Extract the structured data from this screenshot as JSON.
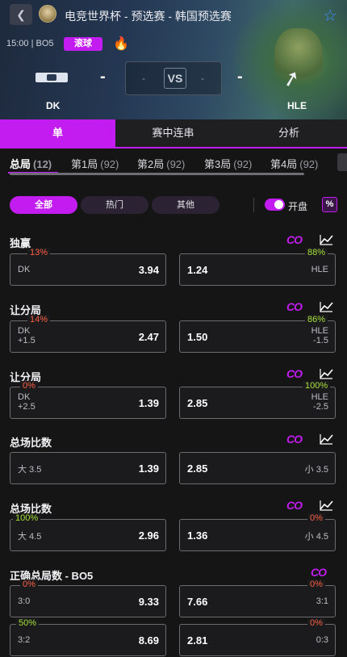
{
  "header": {
    "back_icon": "chevron-left-icon",
    "title": "电竞世界杯 - 预选赛 - 韩国预选赛",
    "time_format": "15:00 | BO5",
    "live_badge": "滚球",
    "fire_icon": "🔥",
    "star_icon": "☆",
    "team_left": "DK",
    "team_right": "HLE",
    "score_left": "-",
    "score_right": "-",
    "vs_label": "VS",
    "vs_left_sub": "-",
    "vs_right_sub": "-"
  },
  "main_tabs": [
    {
      "label": "单",
      "active": true
    },
    {
      "label": "赛中连串",
      "active": false
    },
    {
      "label": "分析",
      "active": false
    }
  ],
  "game_tabs": [
    {
      "label": "总局",
      "count": "(12)",
      "active": true
    },
    {
      "label": "第1局",
      "count": "(92)",
      "active": false
    },
    {
      "label": "第2局",
      "count": "(92)",
      "active": false
    },
    {
      "label": "第3局",
      "count": "(92)",
      "active": false
    },
    {
      "label": "第4局",
      "count": "(92)",
      "active": false
    }
  ],
  "filters": {
    "all": "全部",
    "hot": "热门",
    "other": "其他",
    "toggle_label": "开盘",
    "percent_icon": "%"
  },
  "markets": [
    {
      "title": "独赢",
      "co": "CO",
      "left": {
        "pct": "13%",
        "pct_color": "red",
        "line1": "DK",
        "line2": "",
        "odd": "3.94"
      },
      "right": {
        "pct": "88%",
        "pct_color": "green",
        "line1": "HLE",
        "line2": "",
        "odd": "1.24"
      }
    },
    {
      "title": "让分局",
      "co": "CO",
      "left": {
        "pct": "14%",
        "pct_color": "red",
        "line1": "DK",
        "line2": "+1.5",
        "odd": "2.47"
      },
      "right": {
        "pct": "86%",
        "pct_color": "green",
        "line1": "HLE",
        "line2": "-1.5",
        "odd": "1.50"
      }
    },
    {
      "title": "让分局",
      "co": "CO",
      "left": {
        "pct": "0%",
        "pct_color": "red",
        "line1": "DK",
        "line2": "+2.5",
        "odd": "1.39"
      },
      "right": {
        "pct": "100%",
        "pct_color": "green",
        "line1": "HLE",
        "line2": "-2.5",
        "odd": "2.85"
      }
    },
    {
      "title": "总场比数",
      "co": "CO",
      "left": {
        "pct": "",
        "pct_color": "red",
        "line1": "大 3.5",
        "line2": "",
        "odd": "1.39"
      },
      "right": {
        "pct": "",
        "pct_color": "green",
        "line1": "小 3.5",
        "line2": "",
        "odd": "2.85"
      }
    },
    {
      "title": "总场比数",
      "co": "CO",
      "left": {
        "pct": "100%",
        "pct_color": "green",
        "line1": "大 4.5",
        "line2": "",
        "odd": "2.96"
      },
      "right": {
        "pct": "0%",
        "pct_color": "red",
        "line1": "小 4.5",
        "line2": "",
        "odd": "1.36"
      }
    },
    {
      "title": "正确总局数 - BO5",
      "co": "CO",
      "rows": [
        {
          "left": {
            "pct": "0%",
            "pct_color": "red",
            "line1": "3:0",
            "odd": "9.33"
          },
          "right": {
            "pct": "0%",
            "pct_color": "red",
            "line1": "3:1",
            "odd": "7.66"
          }
        },
        {
          "left": {
            "pct": "50%",
            "pct_color": "green",
            "line1": "3:2",
            "odd": "8.69"
          },
          "right": {
            "pct": "0%",
            "pct_color": "red",
            "line1": "0:3",
            "odd": "2.81"
          }
        }
      ]
    }
  ],
  "colors": {
    "accent": "#c31cf0",
    "pct_red": "#ff5f45",
    "pct_green": "#a6e23a",
    "bg": "#151515"
  }
}
